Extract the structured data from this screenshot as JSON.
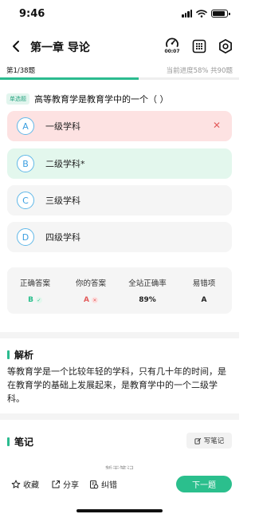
{
  "status_bar": {
    "time": "9:46",
    "battery_level": 0.9
  },
  "nav": {
    "title": "第一章 导论",
    "timer": "00:07",
    "icons": [
      "chevron-left-icon",
      "timer-icon",
      "answer-grid-icon",
      "settings-icon"
    ]
  },
  "progress": {
    "index": "第1/38题",
    "summary": "当前进度58%  共90题",
    "fraction": 0.58
  },
  "question": {
    "type": "单选题",
    "text": "高等教育学是教育学中的一个（   ）",
    "options": [
      {
        "letter": "A",
        "text": "一级学科",
        "state": "wrong"
      },
      {
        "letter": "B",
        "text": "二级学科*",
        "state": "correct"
      },
      {
        "letter": "C",
        "text": "三级学科",
        "state": "normal"
      },
      {
        "letter": "D",
        "text": "四级学科",
        "state": "normal"
      }
    ]
  },
  "stats": {
    "correct_answer_label": "正确答案",
    "correct_answer": "B",
    "your_answer_label": "你的答案",
    "your_answer": "A",
    "accuracy_label": "全站正确率",
    "accuracy": "89%",
    "common_wrong_label": "易错项",
    "common_wrong": "A"
  },
  "analysis": {
    "title": "解析",
    "text": "等教育学是一个比较年轻的学科，只有几十年的时间，是在教育学的基础上发展起来，是教育学中的一个二级学科。"
  },
  "notes": {
    "title": "笔记",
    "write_label": "写笔记",
    "empty_text": "暂无笔记"
  },
  "bottom": {
    "favorite_label": "收藏",
    "share_label": "分享",
    "report_label": "纠错",
    "next_label": "下一题"
  },
  "colors": {
    "accent": "#2bbf8d",
    "wrong_bg": "#fde2e2",
    "correct_bg": "#e3f7ed",
    "option_letter": "#3a9ee0",
    "wrong_mark": "#e35c5c"
  }
}
